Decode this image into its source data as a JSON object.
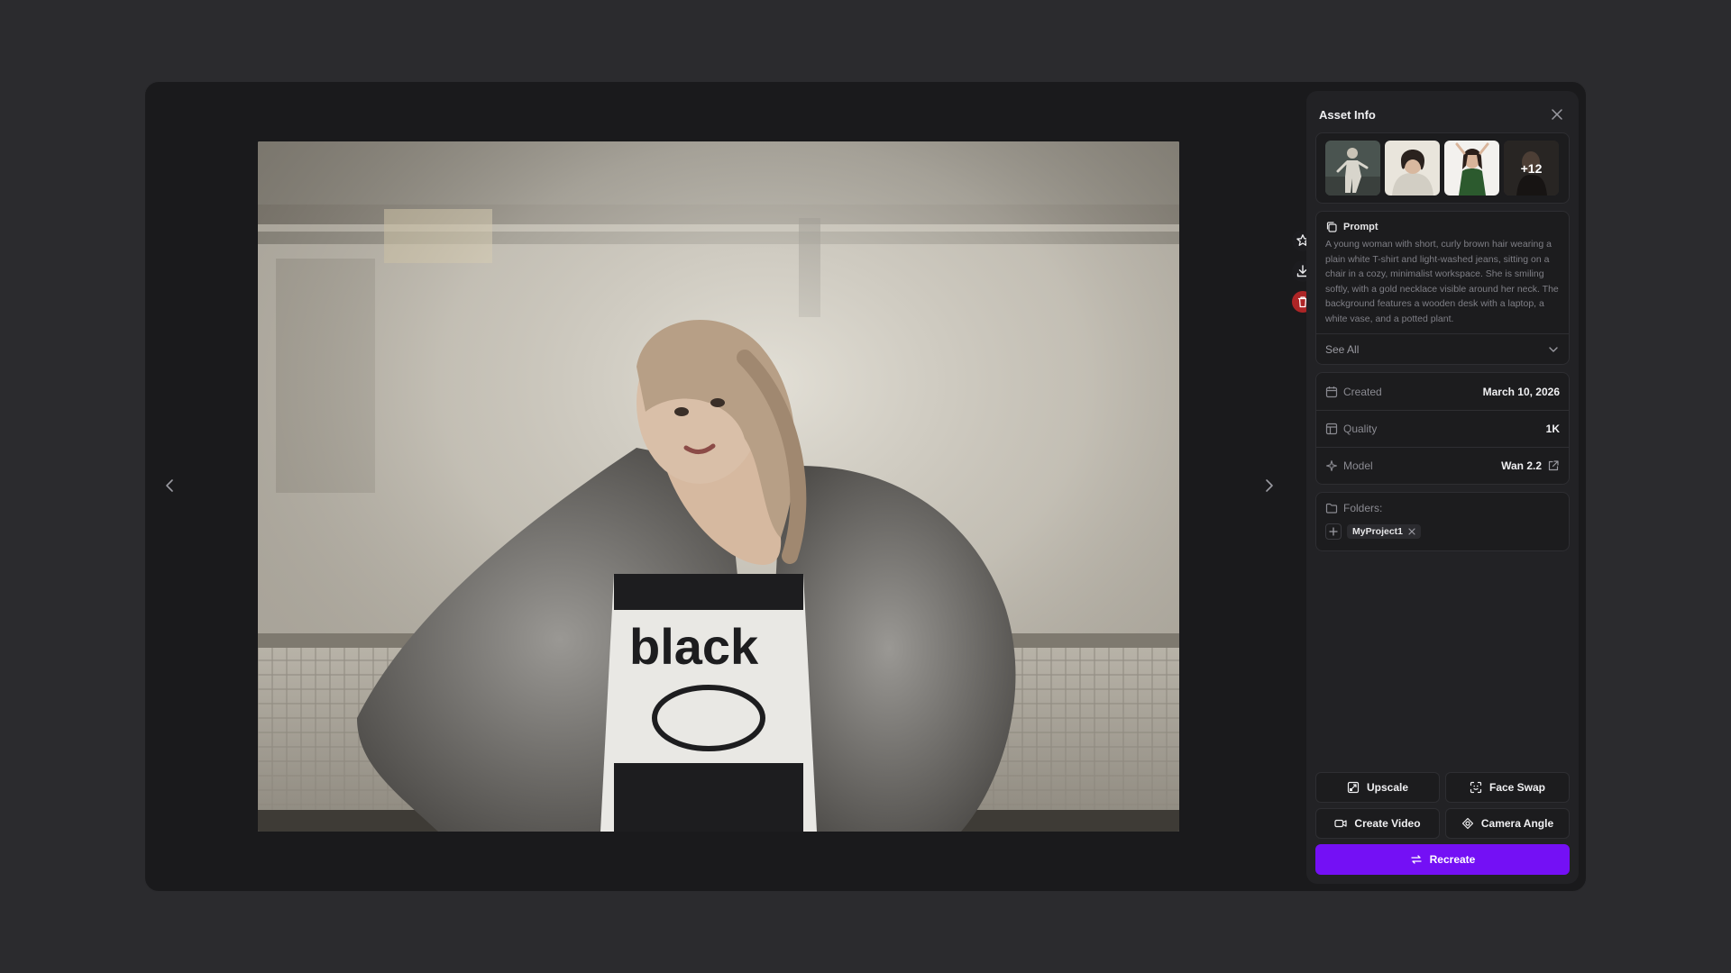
{
  "panel": {
    "title": "Asset Info",
    "thumbnails": [
      {
        "icon": "thumbnail-dancer"
      },
      {
        "icon": "thumbnail-portrait-hoodie"
      },
      {
        "icon": "thumbnail-portrait-green"
      },
      {
        "icon": "thumbnail-more",
        "more_label": "+12"
      }
    ],
    "prompt": {
      "label": "Prompt",
      "text": "A young woman with short, curly brown hair wearing a plain white T-shirt and light-washed jeans, sitting on a chair in a cozy, minimalist workspace. She is smiling softly, with a gold necklace visible around her neck. The background features a wooden desk with a laptop, a white vase, and a potted plant.",
      "see_all": "See All"
    },
    "meta": {
      "created_label": "Created",
      "created_value": "March 10, 2026",
      "quality_label": "Quality",
      "quality_value": "1K",
      "model_label": "Model",
      "model_value": "Wan 2.2"
    },
    "folders": {
      "label": "Folders:",
      "items": [
        "MyProject1"
      ]
    },
    "actions": {
      "upscale": "Upscale",
      "face_swap": "Face Swap",
      "create_video": "Create Video",
      "camera_angle": "Camera Angle",
      "recreate": "Recreate"
    }
  },
  "colors": {
    "accent": "#7410f5",
    "danger": "#c82828",
    "background": "#2b2b2e",
    "modal": "#1a1a1c"
  }
}
